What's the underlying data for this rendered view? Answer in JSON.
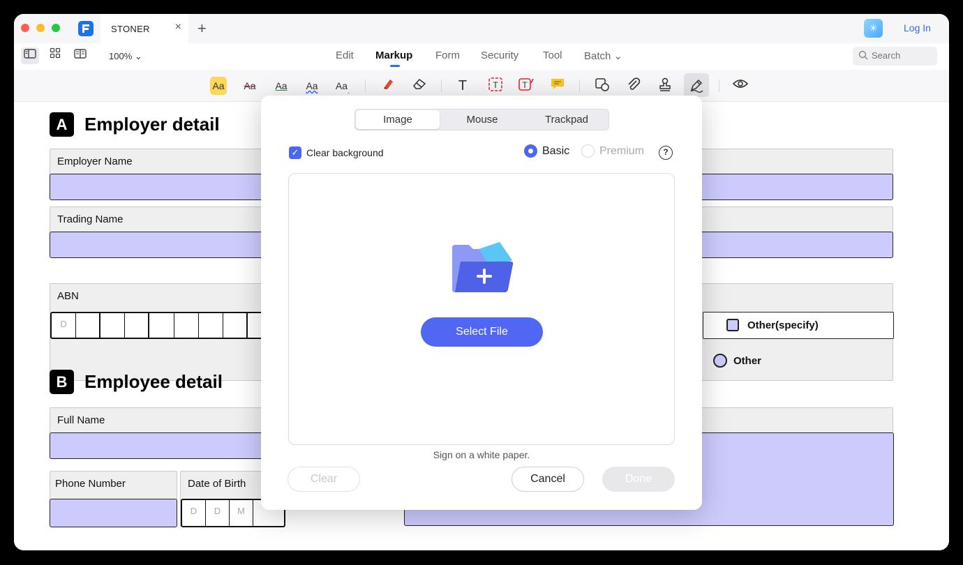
{
  "tab": {
    "title": "STONER",
    "close": "×",
    "add": "+"
  },
  "account": {
    "login_label": "Log In",
    "ai_glyph": "✳"
  },
  "view": {
    "zoom": "100% ⌄"
  },
  "menu": {
    "items": [
      "Edit",
      "Markup",
      "Form",
      "Security",
      "Tool",
      "Batch ⌄"
    ],
    "active": "Markup"
  },
  "search": {
    "placeholder": "Search"
  },
  "toolbar": {
    "tools": [
      "highlight-icon",
      "strikethrough-icon",
      "underline-icon",
      "squiggly-icon",
      "caret-icon",
      "marker-icon",
      "eraser-icon",
      "text-icon",
      "textbox-icon",
      "callout-icon",
      "note-icon",
      "shape-icon",
      "attachment-icon",
      "stamp-icon",
      "signature-icon",
      "eye-icon"
    ],
    "glyphs": {
      "aa": "Aa",
      "t": "T"
    }
  },
  "document": {
    "section_a": {
      "badge": "A",
      "title": "Employer detail"
    },
    "section_b": {
      "badge": "B",
      "title": "Employee detail"
    },
    "labels": {
      "employer_name": "Employer Name",
      "trading_name": "Trading Name",
      "abn": "ABN",
      "full_name": "Full Name",
      "phone_number": "Phone Number",
      "date_of_birth": "Date of Birth"
    },
    "abn_first_cell": "D",
    "dob_cells": [
      "D",
      "D",
      "M"
    ],
    "options": {
      "other_specify": "Other(specify)",
      "other": "Other"
    }
  },
  "signature_dialog": {
    "tabs": [
      "Image",
      "Mouse",
      "Trackpad"
    ],
    "active_tab": "Image",
    "clear_background_label": "Clear background",
    "clear_background_checked": true,
    "mode_options": [
      "Basic",
      "Premium"
    ],
    "mode_selected": "Basic",
    "help_glyph": "?",
    "select_file_label": "Select File",
    "hint": "Sign on a white paper.",
    "buttons": {
      "clear": "Clear",
      "cancel": "Cancel",
      "done": "Done"
    }
  },
  "colors": {
    "accent": "#4f67f2",
    "field_fill": "#cccbfc",
    "link": "#2f6fe4"
  }
}
